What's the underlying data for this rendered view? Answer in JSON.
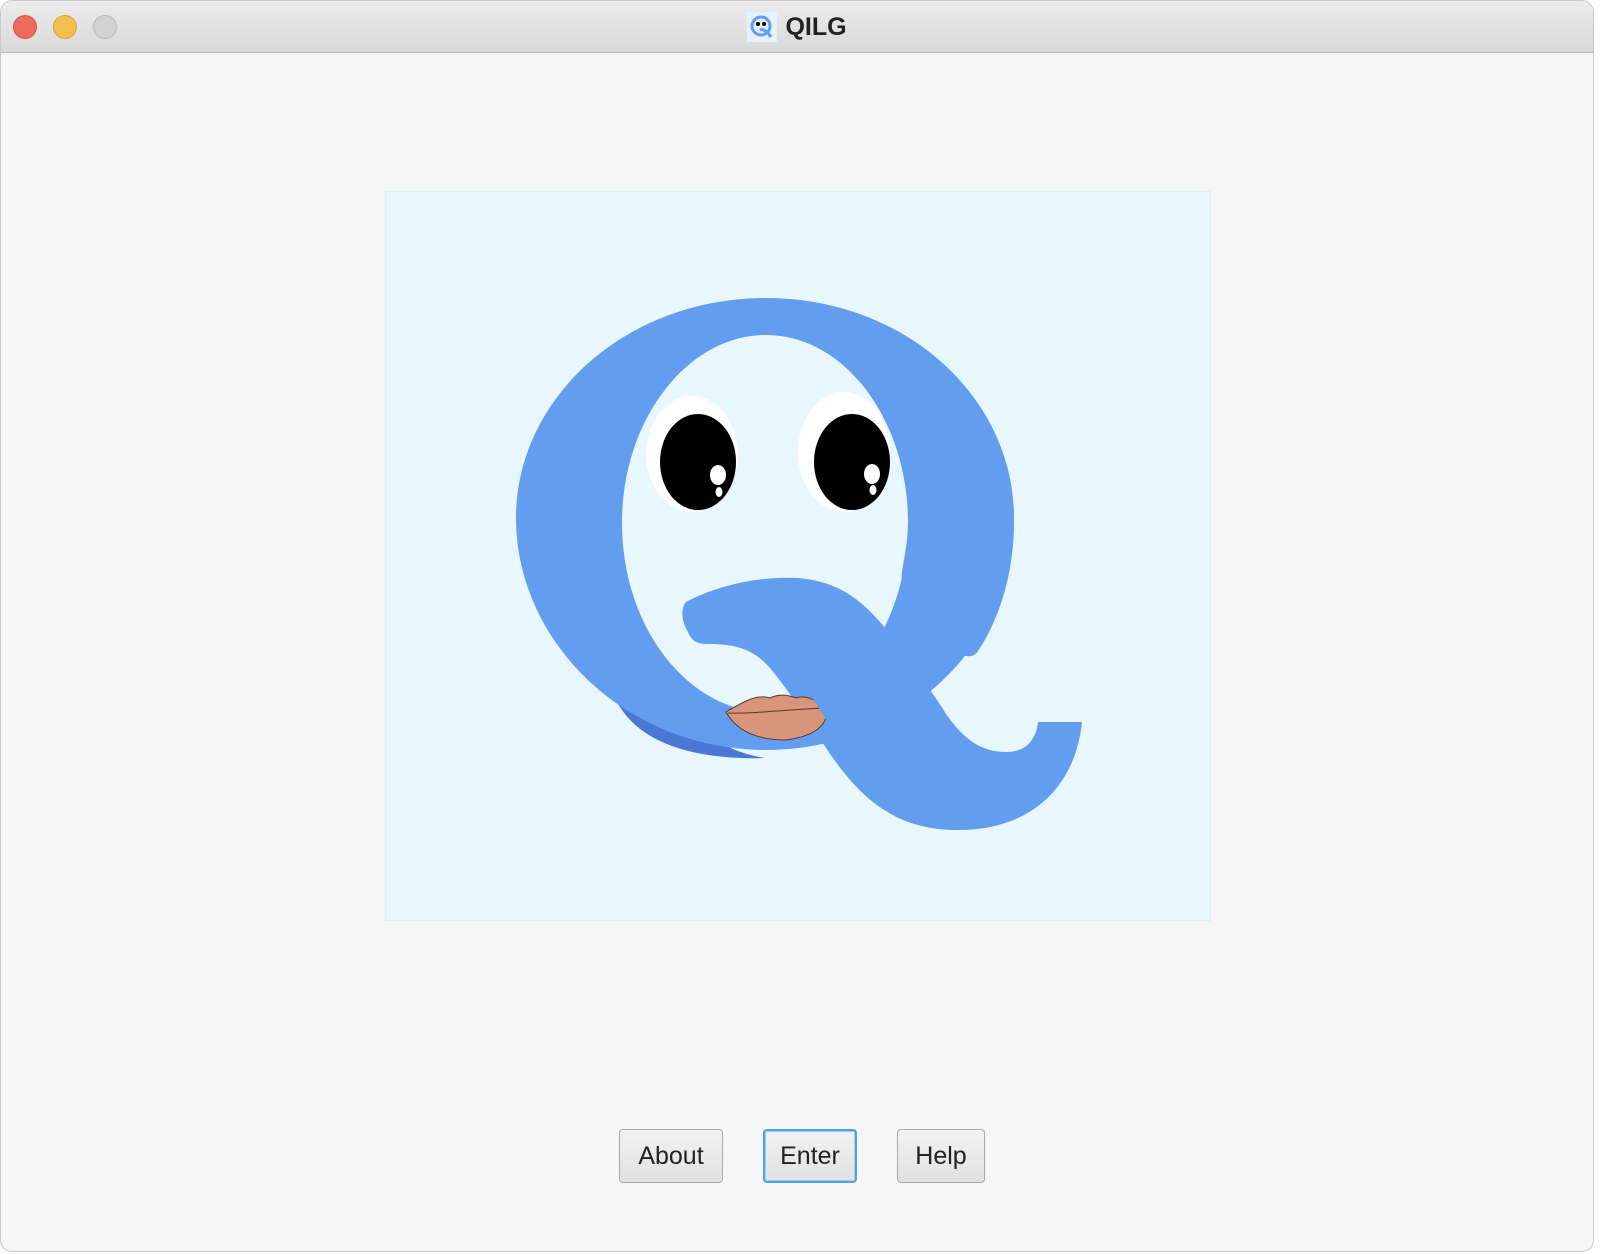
{
  "window": {
    "title": "QILG",
    "title_icon": "qilg-app-icon"
  },
  "window_controls": {
    "close": "close-icon",
    "minimize": "minimize-icon",
    "zoom": "zoom-icon"
  },
  "logo": {
    "icon": "qilg-q-face-logo",
    "colors": {
      "background": "#e8f6fe",
      "letter": "#639df0",
      "letter_shadow": "#4a76d6",
      "lips": "#d8957b",
      "eye_white": "#ffffff",
      "pupil": "#000000"
    }
  },
  "buttons": {
    "about_label": "About",
    "enter_label": "Enter",
    "help_label": "Help",
    "focus_color": "#4aa3e4"
  }
}
